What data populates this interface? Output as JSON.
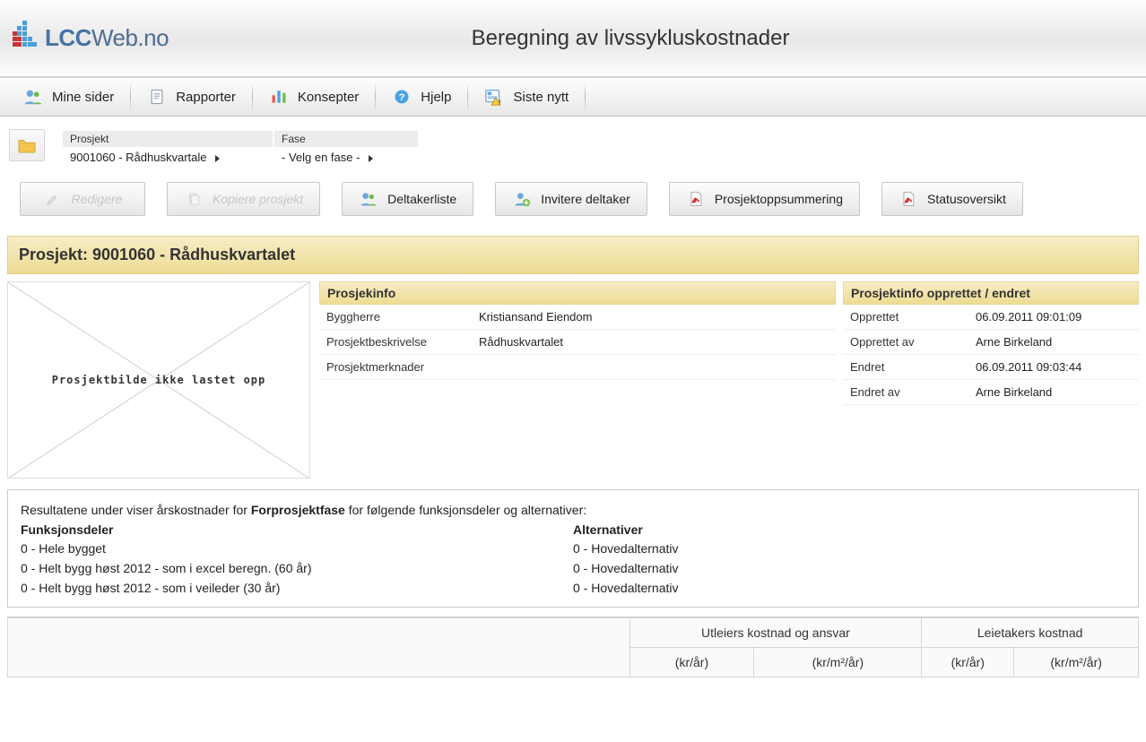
{
  "header": {
    "logo_text_bold": "LCC",
    "logo_text_rest": "Web.no",
    "title": "Beregning av livssykluskostnader"
  },
  "nav": [
    {
      "label": "Mine sider",
      "icon": "users-icon"
    },
    {
      "label": "Rapporter",
      "icon": "document-icon"
    },
    {
      "label": "Konsepter",
      "icon": "bar-chart-icon"
    },
    {
      "label": "Hjelp",
      "icon": "help-icon"
    },
    {
      "label": "Siste nytt",
      "icon": "news-alert-icon"
    }
  ],
  "breadcrumb": {
    "project_label": "Prosjekt",
    "project_value": "9001060 - Rådhuskvartale",
    "phase_label": "Fase",
    "phase_value": "- Velg en fase -"
  },
  "toolbar": [
    {
      "label": "Redigere",
      "icon": "edit-icon",
      "disabled": true
    },
    {
      "label": "Kopiere prosjekt",
      "icon": "copy-icon",
      "disabled": true
    },
    {
      "label": "Deltakerliste",
      "icon": "users-icon",
      "disabled": false
    },
    {
      "label": "Invitere deltaker",
      "icon": "add-user-icon",
      "disabled": false
    },
    {
      "label": "Prosjektoppsummering",
      "icon": "pdf-icon",
      "disabled": false
    },
    {
      "label": "Statusoversikt",
      "icon": "pdf-icon",
      "disabled": false
    }
  ],
  "project": {
    "title": "Prosjekt: 9001060 - Rådhuskvartalet",
    "placeholder_text": "Prosjektbilde ikke lastet opp",
    "info_header": "Prosjekinfo",
    "info_rows": [
      {
        "label": "Byggherre",
        "value": "Kristiansand Eiendom"
      },
      {
        "label": "Prosjektbeskrivelse",
        "value": "Rådhuskvartalet"
      },
      {
        "label": "Prosjektmerknader",
        "value": ""
      }
    ],
    "meta_header": "Prosjektinfo opprettet / endret",
    "meta_rows": [
      {
        "label": "Opprettet",
        "value": "06.09.2011 09:01:09"
      },
      {
        "label": "Opprettet av",
        "value": "Arne Birkeland"
      },
      {
        "label": "Endret",
        "value": "06.09.2011 09:03:44"
      },
      {
        "label": "Endret av",
        "value": "Arne Birkeland"
      }
    ]
  },
  "results": {
    "intro_pre": "Resultatene under viser årskostnader for ",
    "intro_phase": "Forprosjektfase",
    "intro_post": " for følgende funksjonsdeler og alternativer:",
    "funksjonsdeler_header": "Funksjonsdeler",
    "funksjonsdeler": [
      "0 - Hele bygget",
      "0 - Helt bygg høst 2012 - som i excel beregn. (60 år)",
      "0 - Helt bygg høst 2012 - som i veileder (30 år)"
    ],
    "alternativer_header": "Alternativer",
    "alternativer": [
      "0 - Hovedalternativ",
      "0 - Hovedalternativ",
      "0 - Hovedalternativ"
    ]
  },
  "cost_table": {
    "group1": "Utleiers kostnad og ansvar",
    "group2": "Leietakers kostnad",
    "unit1": "(kr/år)",
    "unit2": "(kr/m²/år)",
    "unit3": "(kr/år)",
    "unit4": "(kr/m²/år)"
  }
}
